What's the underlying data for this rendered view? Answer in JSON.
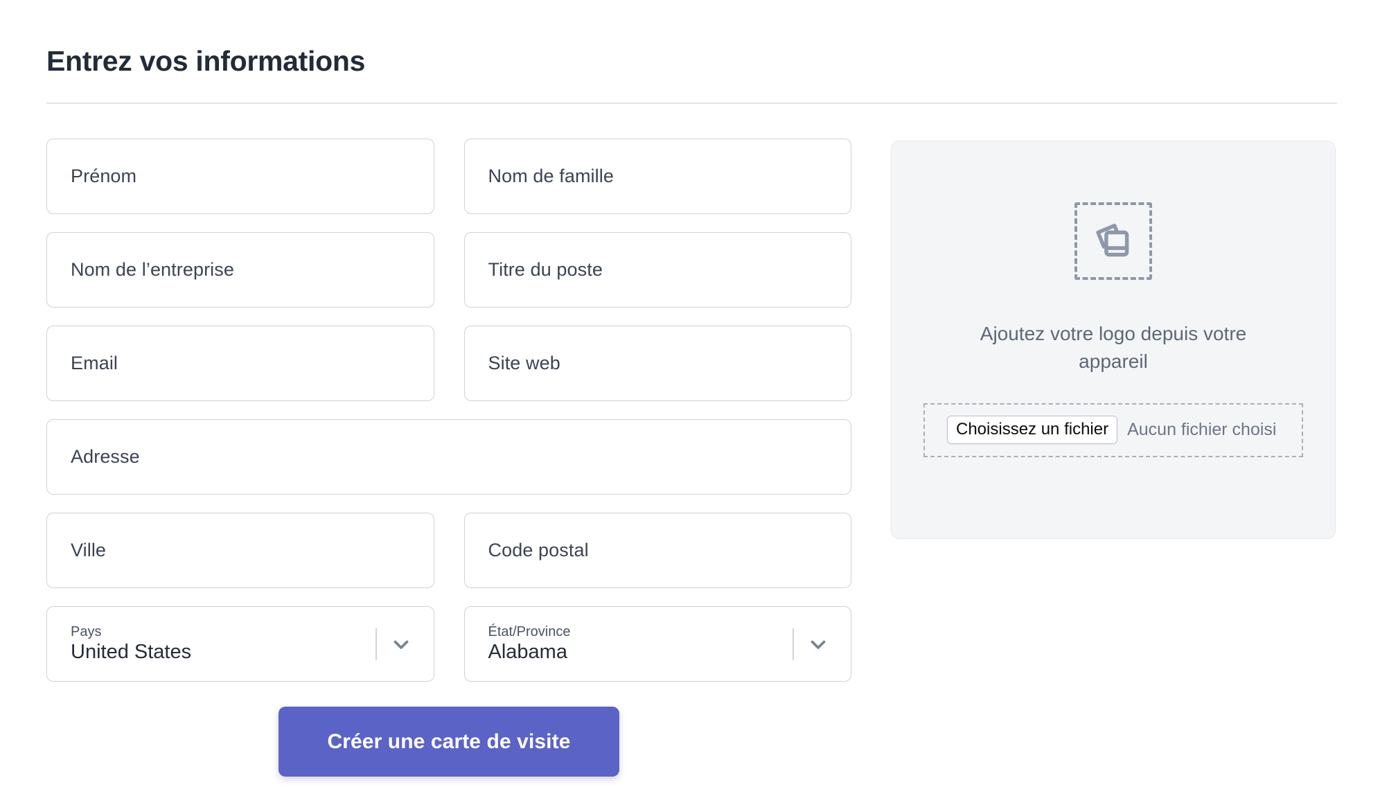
{
  "header": {
    "title": "Entrez vos informations"
  },
  "form": {
    "rows": [
      {
        "fields": [
          {
            "name": "first-name",
            "placeholder": "Prénom",
            "type": "text"
          },
          {
            "name": "last-name",
            "placeholder": "Nom de famille",
            "type": "text"
          }
        ]
      },
      {
        "fields": [
          {
            "name": "company-name",
            "placeholder": "Nom de l’entreprise",
            "type": "text"
          },
          {
            "name": "job-title",
            "placeholder": "Titre du poste",
            "type": "text"
          }
        ]
      },
      {
        "fields": [
          {
            "name": "email",
            "placeholder": "Email",
            "type": "text"
          },
          {
            "name": "website",
            "placeholder": "Site web",
            "type": "text"
          }
        ]
      },
      {
        "fields": [
          {
            "name": "address",
            "placeholder": "Adresse",
            "type": "text",
            "full": true
          }
        ]
      },
      {
        "fields": [
          {
            "name": "city",
            "placeholder": "Ville",
            "type": "text"
          },
          {
            "name": "postal-code",
            "placeholder": "Code postal",
            "type": "text"
          }
        ]
      }
    ],
    "selects": [
      {
        "name": "country",
        "label": "Pays",
        "value": "United States",
        "icon": "chevron-down-icon"
      },
      {
        "name": "state-province",
        "label": "État/Province",
        "value": "Alabama",
        "icon": "chevron-down-icon"
      }
    ],
    "submit": {
      "label": "Créer une carte de visite",
      "color": "#5b63c7"
    }
  },
  "upload": {
    "icon": "photo-stack-icon",
    "caption": "Ajoutez votre logo depuis votre appareil",
    "file_input": {
      "button_label": "Choisissez un fichier",
      "status_text": "Aucun fichier choisi"
    },
    "panel_color": "#f4f5f7"
  },
  "colors": {
    "accent": "#5b63c7",
    "title": "#222b38",
    "border": "#ccd2da",
    "muted_text": "#5e6777",
    "divider": "#e3e5ea"
  }
}
